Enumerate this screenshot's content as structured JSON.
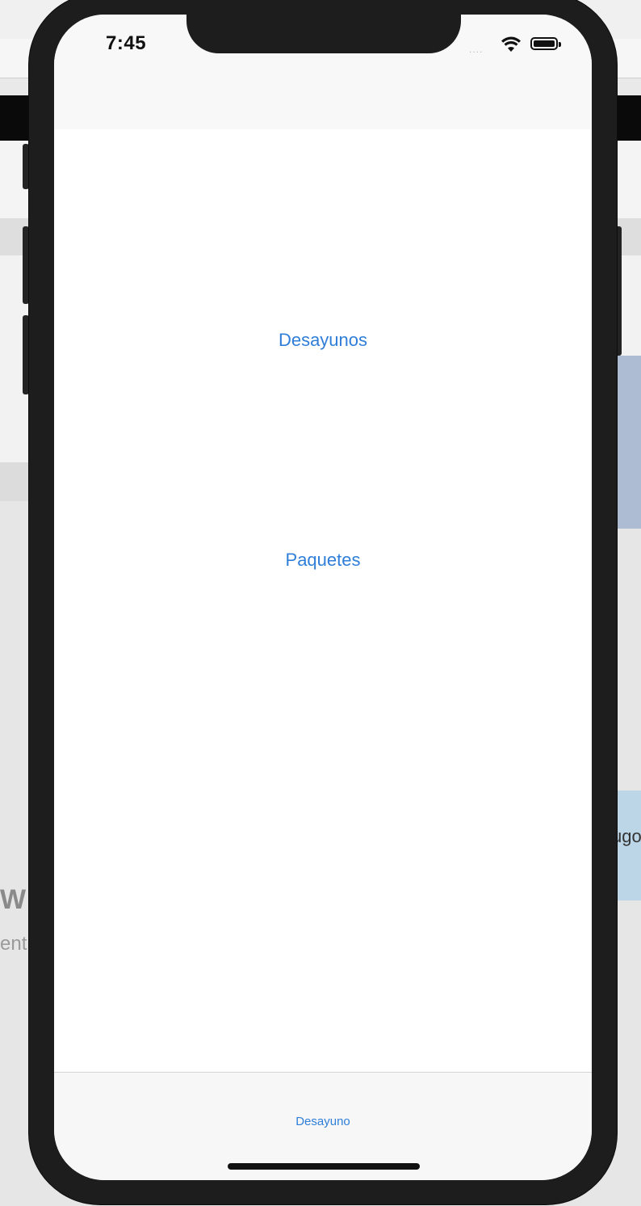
{
  "status_bar": {
    "time": "7:45",
    "signal": "....",
    "wifi_icon": "wifi-icon",
    "battery_icon": "battery-icon"
  },
  "main": {
    "buttons": [
      {
        "label": "Desayunos"
      },
      {
        "label": "Paquetes"
      }
    ]
  },
  "tab_bar": {
    "items": [
      {
        "label": "Desayuno",
        "active": true
      }
    ]
  },
  "background": {
    "fragment_right": "ugo",
    "fragment_heading": "W",
    "fragment_text": "ent"
  },
  "colors": {
    "accent": "#2f7ed8",
    "device_frame": "#1d1d1d"
  }
}
